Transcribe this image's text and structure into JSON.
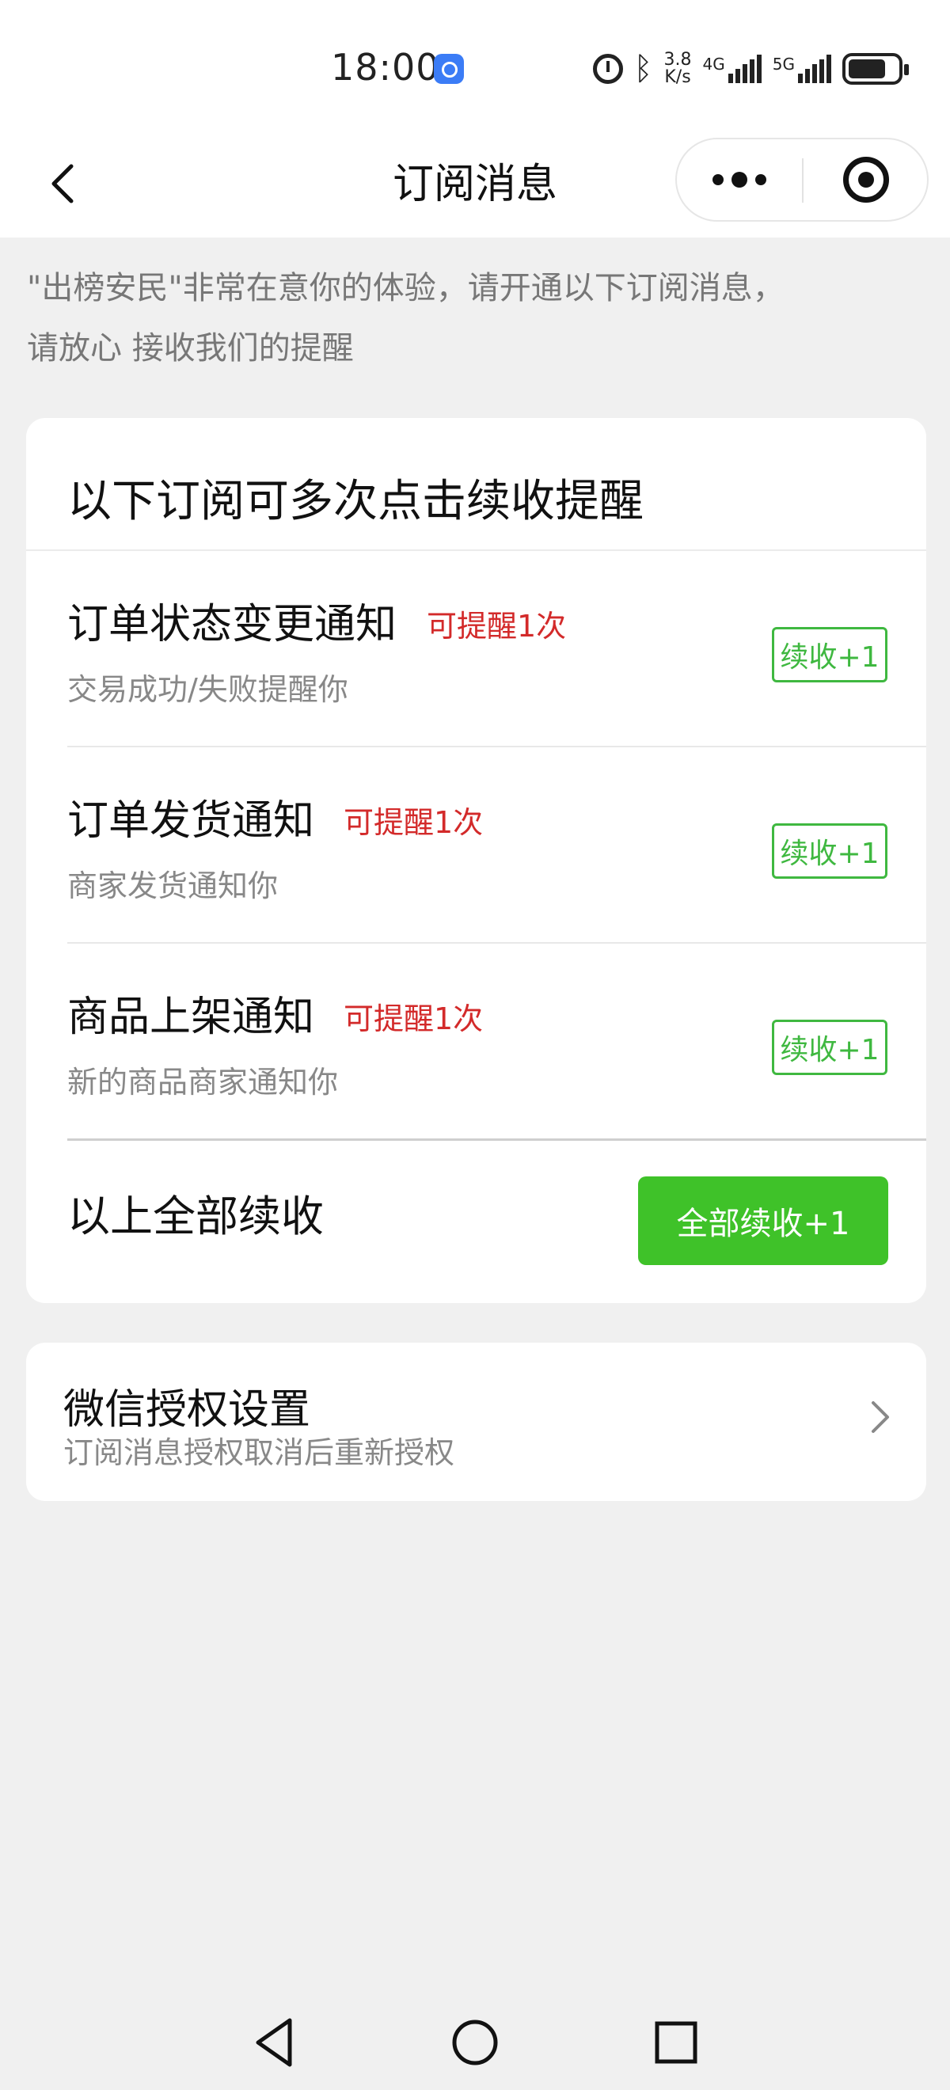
{
  "status_bar": {
    "time": "18:00",
    "speed_value": "3.8",
    "speed_unit": "K/s",
    "net1": "4G",
    "net2": "5G",
    "icons": [
      "app-badge-icon",
      "alarm-icon",
      "bluetooth-icon",
      "signal-icon",
      "battery-icon"
    ]
  },
  "nav": {
    "title": "订阅消息",
    "back_icon": "chevron-left-icon",
    "more_icon": "more-dots-icon",
    "close_icon": "target-close-icon"
  },
  "intro": {
    "line1": "\"出榜安民\"非常在意你的体验，请开通以下订阅消息，",
    "line2": "请放心 接收我们的提醒"
  },
  "card": {
    "title": "以下订阅可多次点击续收提醒",
    "items": [
      {
        "name": "订单状态变更通知",
        "remain": "可提醒1次",
        "desc": "交易成功/失败提醒你",
        "button": "续收+1"
      },
      {
        "name": "订单发货通知",
        "remain": "可提醒1次",
        "desc": "商家发货通知你",
        "button": "续收+1"
      },
      {
        "name": "商品上架通知",
        "remain": "可提醒1次",
        "desc": "新的商品商家通知你",
        "button": "续收+1"
      }
    ],
    "all_label": "以上全部续收",
    "all_button": "全部续收+1"
  },
  "settings": {
    "title": "微信授权设置",
    "subtitle": "订阅消息授权取消后重新授权",
    "icon": "chevron-right-icon"
  },
  "system_nav": {
    "icons": [
      "back-triangle-icon",
      "home-circle-icon",
      "recents-square-icon"
    ]
  },
  "colors": {
    "accent_green": "#3fc229",
    "outline_green": "#3fb840",
    "remain_red": "#d32a2a",
    "background": "#f0f0f0"
  }
}
